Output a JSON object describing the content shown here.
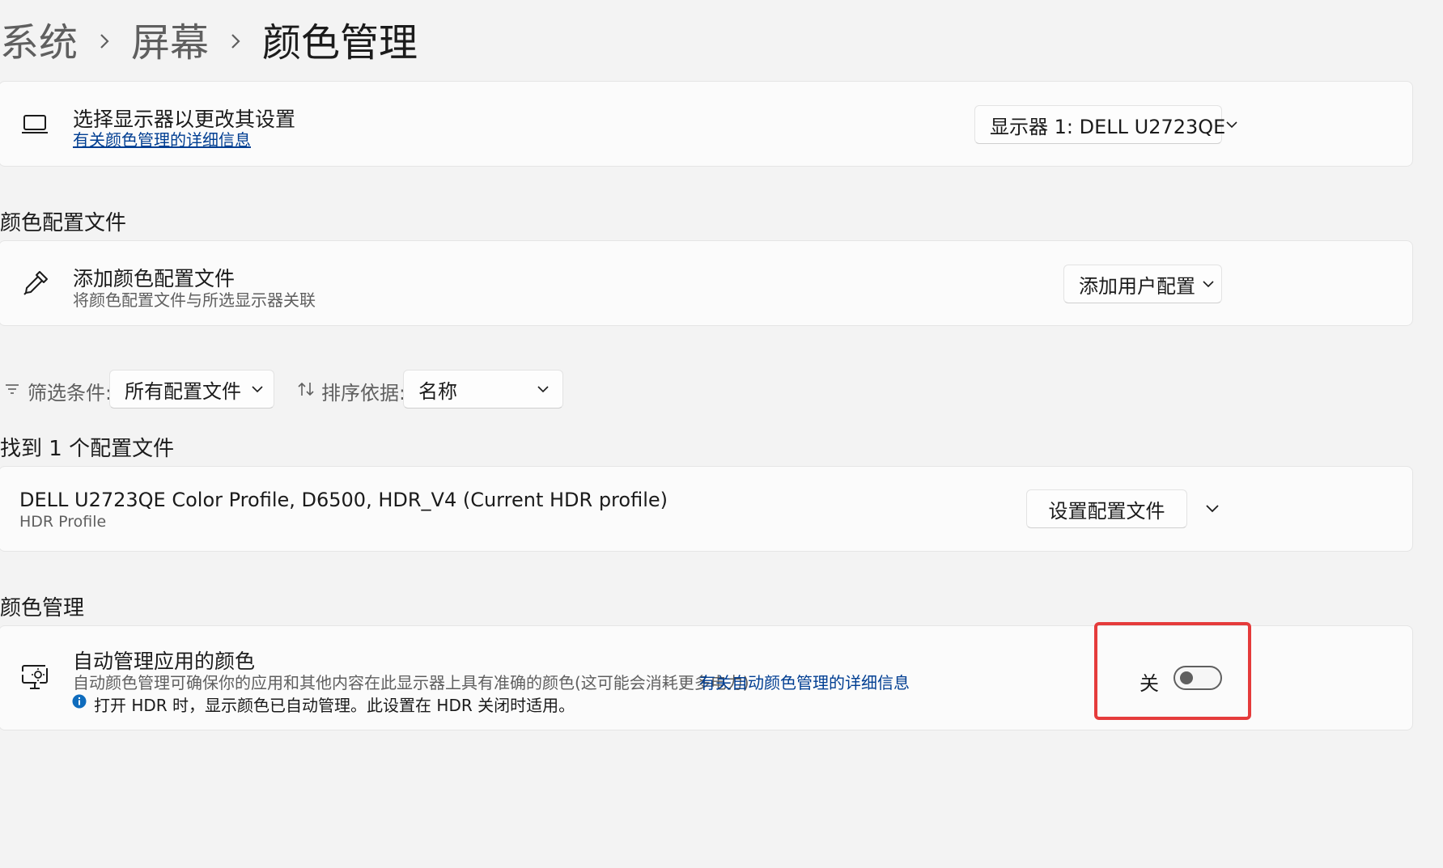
{
  "breadcrumb": {
    "items": [
      "系统",
      "屏幕",
      "颜色管理"
    ]
  },
  "display_select": {
    "title": "选择显示器以更改其设置",
    "link": "有关颜色管理的详细信息",
    "selected_display": "显示器 1: DELL U2723QE",
    "icon": "laptop-icon"
  },
  "color_profiles_section": {
    "title": "颜色配置文件",
    "add_profile": {
      "title": "添加颜色配置文件",
      "subtitle": "将颜色配置文件与所选显示器关联",
      "button_label": "添加用户配置",
      "icon": "eyedropper-icon"
    },
    "filter": {
      "label": "筛选条件:",
      "selected": "所有配置文件"
    },
    "sort": {
      "label": "排序依据:",
      "selected": "名称"
    },
    "found_text": "找到 1 个配置文件",
    "profiles": [
      {
        "name": "DELL U2723QE Color Profile, D6500, HDR_V4 (Current HDR profile)",
        "type": "HDR Profile",
        "button_label": "设置配置文件"
      }
    ]
  },
  "color_management_section": {
    "title": "颜色管理",
    "auto_manage": {
      "title": "自动管理应用的颜色",
      "description": "自动颜色管理可确保你的应用和其他内容在此显示器上具有准确的颜色(这可能会消耗更多电力)",
      "link": "有关自动颜色管理的详细信息",
      "info_text": "打开 HDR 时，显示颜色已自动管理。此设置在 HDR 关闭时适用。",
      "toggle_label": "关",
      "toggle_on": false,
      "icon": "color-display-icon"
    }
  },
  "colors": {
    "accent_link": "#003e92",
    "highlight": "#e53b3b",
    "info_badge": "#0f6cbd"
  }
}
